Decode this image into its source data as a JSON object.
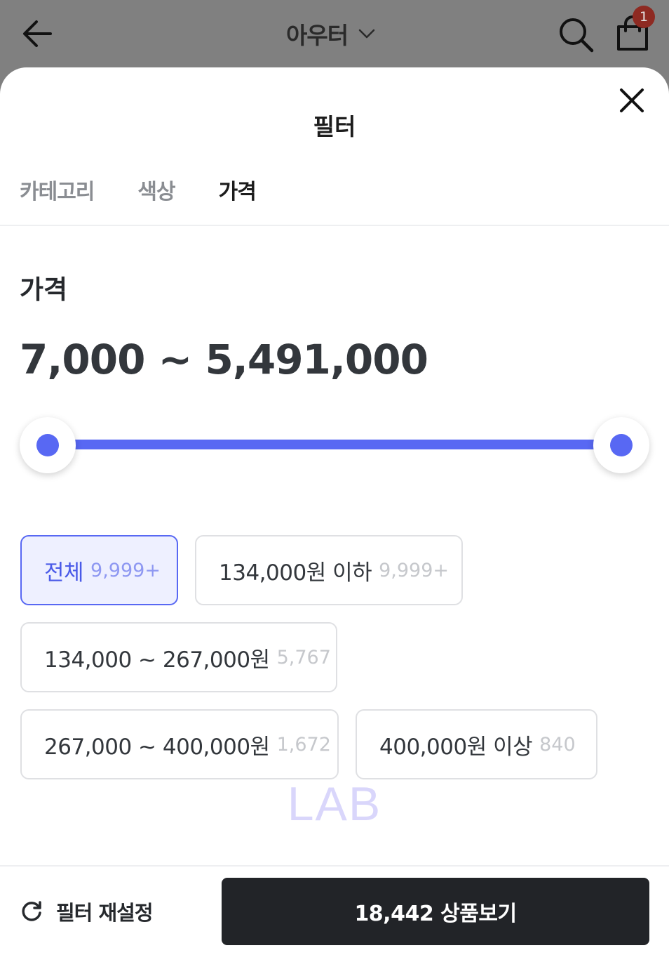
{
  "header": {
    "title": "아우터",
    "back_icon": "arrow-left-icon",
    "dropdown_icon": "chevron-down-icon",
    "search_icon": "search-icon",
    "cart_icon": "shopping-bag-icon",
    "cart_badge": "1"
  },
  "sheet": {
    "title": "필터",
    "close_icon": "close-icon",
    "tabs": [
      {
        "label": "카테고리",
        "active": false
      },
      {
        "label": "색상",
        "active": false
      },
      {
        "label": "가격",
        "active": true
      }
    ],
    "section_title": "가격",
    "price_range": "7,000 ~ 5,491,000",
    "slider": {
      "min_fraction": 0,
      "max_fraction": 1,
      "accent": "#5868f3"
    },
    "chips": [
      {
        "label": "전체",
        "count": "9,999+",
        "selected": true
      },
      {
        "label": "134,000원 이하",
        "count": "9,999+",
        "selected": false
      },
      {
        "label": "134,000 ~ 267,000원",
        "count": "5,767",
        "selected": false
      },
      {
        "label": "267,000 ~ 400,000원",
        "count": "1,672",
        "selected": false
      },
      {
        "label": "400,000원 이상",
        "count": "840",
        "selected": false
      }
    ],
    "watermark": "LAB"
  },
  "footer": {
    "reset_icon": "refresh-icon",
    "reset_label": "필터 재설정",
    "submit_label": "18,442 상품보기"
  },
  "colors": {
    "accent": "#5868f3",
    "overlay": "#808080",
    "submit_bg": "#222428",
    "badge": "#8e2a22"
  }
}
